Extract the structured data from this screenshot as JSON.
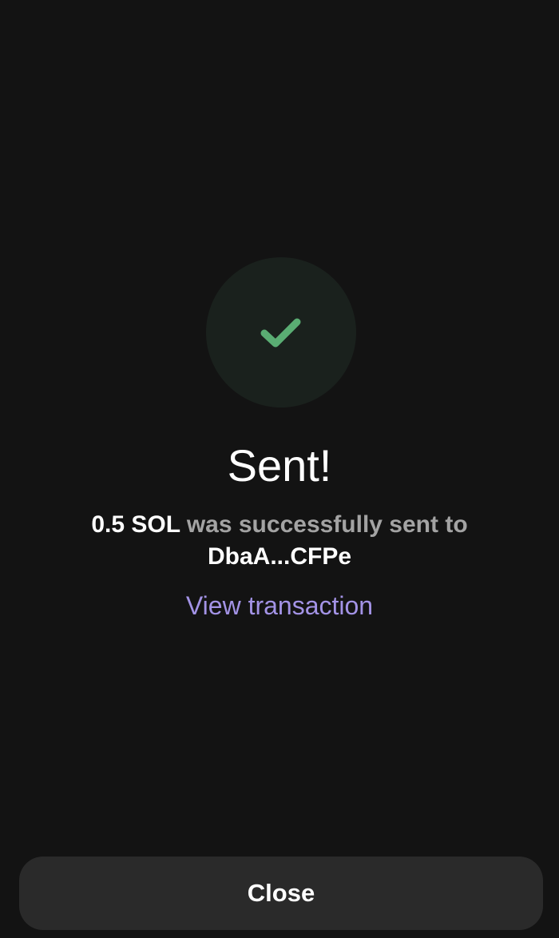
{
  "status": {
    "title": "Sent!",
    "icon": "check-icon",
    "icon_color": "#5aad73",
    "circle_color": "#1a211d"
  },
  "message": {
    "amount": "0.5 SOL",
    "text": " was successfully sent to",
    "recipient": "DbaA...CFPe"
  },
  "links": {
    "view_transaction": "View transaction"
  },
  "actions": {
    "close_label": "Close"
  },
  "colors": {
    "background": "#131313",
    "link": "#a393e6",
    "button": "#2a2a2a"
  }
}
